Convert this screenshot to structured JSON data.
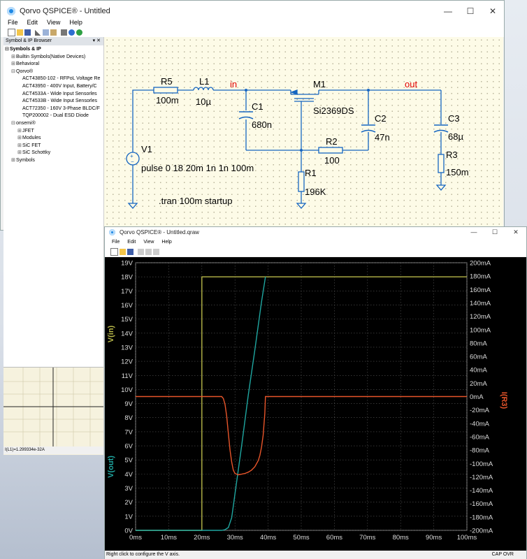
{
  "main_window": {
    "title": "Qorvo QSPICE® - Untitled",
    "menu": [
      "File",
      "Edit",
      "View",
      "Help"
    ]
  },
  "window_buttons": {
    "minimize": "—",
    "maximize": "☐",
    "close": "✕"
  },
  "browser": {
    "title": "Symbol & IP Browser",
    "controls": "▾ ✕",
    "tree": [
      {
        "label": "Symbols & IP",
        "expander": "⊟",
        "indent": 0,
        "bold": true
      },
      {
        "label": "Builtin Symbols(Native Devices)",
        "expander": "⊞",
        "indent": 1
      },
      {
        "label": "Behavioral",
        "expander": "⊞",
        "indent": 1
      },
      {
        "label": "Qorvo®",
        "expander": "⊟",
        "indent": 1
      },
      {
        "label": "ACT43850-102 - RFPoL Voltage Re",
        "expander": "",
        "indent": 2
      },
      {
        "label": "ACT43950 - 400V Input, Battery/C",
        "expander": "",
        "indent": 2
      },
      {
        "label": "ACT4533A - Wide Input Sensorles",
        "expander": "",
        "indent": 2
      },
      {
        "label": "ACT4533B - Wide Input Sensorles",
        "expander": "",
        "indent": 2
      },
      {
        "label": "ACT72350 - 160V 3-Phase BLDC/F",
        "expander": "",
        "indent": 2
      },
      {
        "label": "TQP200002 - Dual ESD Diode",
        "expander": "",
        "indent": 2
      },
      {
        "label": "onsemi®",
        "expander": "⊟",
        "indent": 1
      },
      {
        "label": "JFET",
        "expander": "⊞",
        "indent": 2
      },
      {
        "label": "Modules",
        "expander": "⊞",
        "indent": 2
      },
      {
        "label": "SiC FET",
        "expander": "⊞",
        "indent": 2
      },
      {
        "label": "SiC Schottky",
        "expander": "⊞",
        "indent": 2
      },
      {
        "label": "Symbols",
        "expander": "⊞",
        "indent": 1
      }
    ],
    "status": "I(L1)=1.299334e-32A"
  },
  "schematic": {
    "components": {
      "R5": {
        "name": "R5",
        "value": "100m"
      },
      "L1": {
        "name": "L1",
        "value": "10µ"
      },
      "C1": {
        "name": "C1",
        "value": "680n"
      },
      "M1": {
        "name": "M1",
        "value": "Si2369DS"
      },
      "C2": {
        "name": "C2",
        "value": "47n"
      },
      "R2": {
        "name": "R2",
        "value": "100"
      },
      "R1": {
        "name": "R1",
        "value": "196K"
      },
      "C3": {
        "name": "C3",
        "value": "68µ"
      },
      "R3": {
        "name": "R3",
        "value": "150m"
      },
      "V1": {
        "name": "V1",
        "value": "pulse 0 18 20m 1n 1n 100m"
      }
    },
    "net_in": "in",
    "net_out": "out",
    "directive": ".tran 100m startup",
    "colors": {
      "net_label": "#e00000",
      "wire": "#1565c0",
      "component": "#1565c0"
    }
  },
  "wave_window": {
    "title": "Qorvo QSPICE® - Untitled.qraw",
    "menu": [
      "File",
      "Edit",
      "View",
      "Help"
    ],
    "status_left": "Right click to configure the V axis.",
    "status_right": "CAP  OVR"
  },
  "chart_data": {
    "type": "line",
    "xlabel": "",
    "x_ticks": [
      "0ms",
      "10ms",
      "20ms",
      "30ms",
      "40ms",
      "50ms",
      "60ms",
      "70ms",
      "80ms",
      "90ms",
      "100ms"
    ],
    "xlim": [
      0,
      100
    ],
    "left_ticks": [
      "0V",
      "1V",
      "2V",
      "3V",
      "4V",
      "5V",
      "6V",
      "7V",
      "8V",
      "9V",
      "10V",
      "11V",
      "12V",
      "13V",
      "14V",
      "15V",
      "16V",
      "17V",
      "18V",
      "19V"
    ],
    "ylim_left": [
      0,
      19
    ],
    "right_ticks": [
      "-200mA",
      "-180mA",
      "-160mA",
      "-140mA",
      "-120mA",
      "-100mA",
      "-80mA",
      "-60mA",
      "-40mA",
      "-20mA",
      "0mA",
      "20mA",
      "40mA",
      "60mA",
      "80mA",
      "100mA",
      "120mA",
      "140mA",
      "160mA",
      "180mA",
      "200mA"
    ],
    "ylim_right": [
      -200,
      200
    ],
    "grid": true,
    "series": [
      {
        "name": "V(in)",
        "axis": "left",
        "color": "#b8b84a",
        "x": [
          0,
          20,
          20.01,
          100
        ],
        "y": [
          0,
          0,
          18,
          18
        ]
      },
      {
        "name": "V(out)",
        "axis": "left",
        "color": "#1fa6a0",
        "x": [
          0,
          26,
          27,
          28,
          29,
          30,
          32,
          34,
          36,
          38,
          39.2
        ],
        "y": [
          0,
          0,
          0.05,
          0.2,
          0.9,
          2.6,
          6,
          9.6,
          12.8,
          16.2,
          18
        ]
      },
      {
        "name": "I(R3)",
        "axis": "right",
        "color": "#e8552a",
        "x": [
          0,
          26,
          26.5,
          27,
          27.5,
          28,
          28.5,
          29,
          29.5,
          30,
          31,
          32,
          33,
          34,
          35,
          36,
          37,
          37.5,
          38,
          38.5,
          39,
          39.2,
          100
        ],
        "y": [
          0,
          0,
          -3,
          -12,
          -30,
          -55,
          -80,
          -98,
          -110,
          -115,
          -117,
          -116,
          -115,
          -113,
          -110,
          -105,
          -96,
          -88,
          -76,
          -58,
          -25,
          0,
          0
        ]
      }
    ]
  }
}
